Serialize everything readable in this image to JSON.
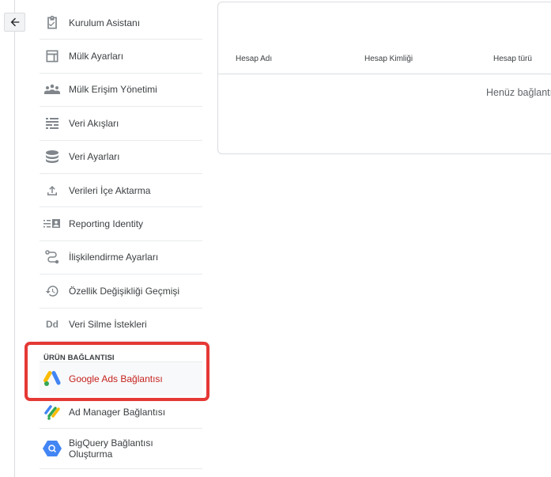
{
  "back_button": {
    "icon": "arrow-left-icon"
  },
  "nav": {
    "items": [
      {
        "label": "Kurulum Asistanı",
        "icon": "clipboard-check-icon"
      },
      {
        "label": "Mülk Ayarları",
        "icon": "layout-icon"
      },
      {
        "label": "Mülk Erişim Yönetimi",
        "icon": "people-icon"
      },
      {
        "label": "Veri Akışları",
        "icon": "streams-icon"
      },
      {
        "label": "Veri Ayarları",
        "icon": "database-icon"
      },
      {
        "label": "Verileri İçe Aktarma",
        "icon": "upload-icon"
      },
      {
        "label": "Reporting Identity",
        "icon": "identity-icon"
      },
      {
        "label": "İlişkilendirme Ayarları",
        "icon": "route-icon"
      },
      {
        "label": "Özellik Değişikliği Geçmişi",
        "icon": "history-icon"
      },
      {
        "label": "Veri Silme İstekleri",
        "icon": "data-deletion-icon"
      }
    ]
  },
  "product_links": {
    "title": "ÜRÜN BAĞLANTISI",
    "items": [
      {
        "label": "Google Ads Bağlantısı",
        "icon": "google-ads-icon",
        "active": true
      },
      {
        "label": "Ad Manager Bağlantısı",
        "icon": "ad-manager-icon"
      },
      {
        "label": "BigQuery Bağlantısı Oluşturma",
        "icon": "bigquery-icon"
      }
    ]
  },
  "table": {
    "columns": [
      "Hesap Adı",
      "Hesap Kimliği",
      "Hesap türü"
    ],
    "empty_text": "Henüz bağlantı yok"
  },
  "colors": {
    "highlight": "#e53935",
    "active_text": "#c5221f"
  }
}
